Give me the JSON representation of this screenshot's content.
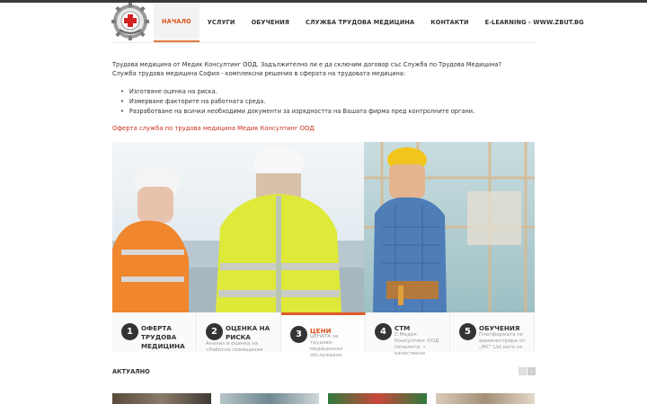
{
  "nav": {
    "items": [
      {
        "label": "НАЧАЛО",
        "active": true
      },
      {
        "label": "УСЛУГИ"
      },
      {
        "label": "ОБУЧЕНИЯ"
      },
      {
        "label": "СЛУЖБА ТРУДОВА МЕДИЦИНА"
      },
      {
        "label": "КОНТАКТИ"
      },
      {
        "label": "E-LEARNING - WWW.ZBUT.BG"
      }
    ]
  },
  "intro": {
    "line1": "Трудова медицина от Медик Консултинг ООД. Задължително ли е да сключим договор със Служба по Трудова Медицина?",
    "line2": "Служба трудова медицина София - комплексни решения в сферата на трудовата медицина:",
    "bullets": [
      "Изготвяне оценка на риска.",
      "Измерване факторите на работната среда.",
      "Разработване на всички необходими документи за изрядността на Вашата фирма пред контролните органи."
    ],
    "offer_link": "Оферта служба по трудова медицина Медик Консултинг ООД"
  },
  "steps": [
    {
      "num": "1",
      "title": "ОФЕРТА ТРУДОВА МЕДИЦИНА",
      "desc": ""
    },
    {
      "num": "2",
      "title": "ОЦЕНКА НА РИСКА",
      "desc": "Анализ и оценка на «Работни помещения"
    },
    {
      "num": "3",
      "title": "ЦЕНИ",
      "desc": "ЦЕНАТА за трудово-медицинско обслужване",
      "active": true
    },
    {
      "num": "4",
      "title": "СТМ",
      "desc": "С Медик Консултинг ООД печелите: • качествени"
    },
    {
      "num": "5",
      "title": "ОБУЧЕНИЯ",
      "desc": "Платформата се администрира от „МС\" Ltd като се"
    }
  ],
  "news": {
    "title": "АКТУАЛНО",
    "prev": "‹",
    "next": "›"
  },
  "colors": {
    "accent": "#d9531e",
    "link": "#c9301f",
    "dark": "#333333"
  }
}
